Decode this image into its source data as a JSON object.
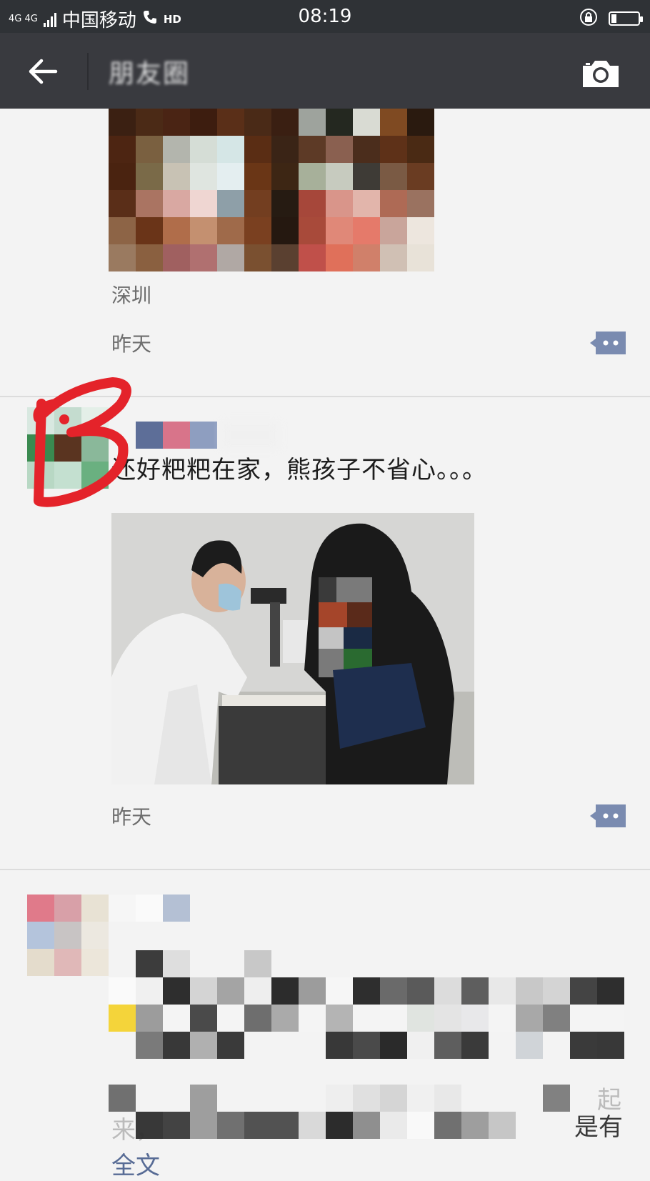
{
  "status_bar": {
    "network": "4G 4G",
    "carrier": "中国移动",
    "hd": "HD",
    "time": "08:19",
    "battery_level": 0.2
  },
  "nav": {
    "title": "朋友圈"
  },
  "posts": [
    {
      "location": "深圳",
      "time": "昨天"
    },
    {
      "text": "还好粑粑在家，熊孩子不省心。。。",
      "time": "昨天"
    },
    {
      "partial_text_right_1": "起",
      "partial_text_right_2": "是有",
      "partial_text_left_1": "来，",
      "partial_text_left_2": "全文"
    }
  ],
  "annotation": {
    "letter": "B"
  },
  "colors": {
    "status_bar": "#2f3236",
    "nav_bar": "#393a3f",
    "background": "#f3f3f3",
    "comment_icon": "#7a8bb0",
    "annotation_red": "#e4232a"
  }
}
